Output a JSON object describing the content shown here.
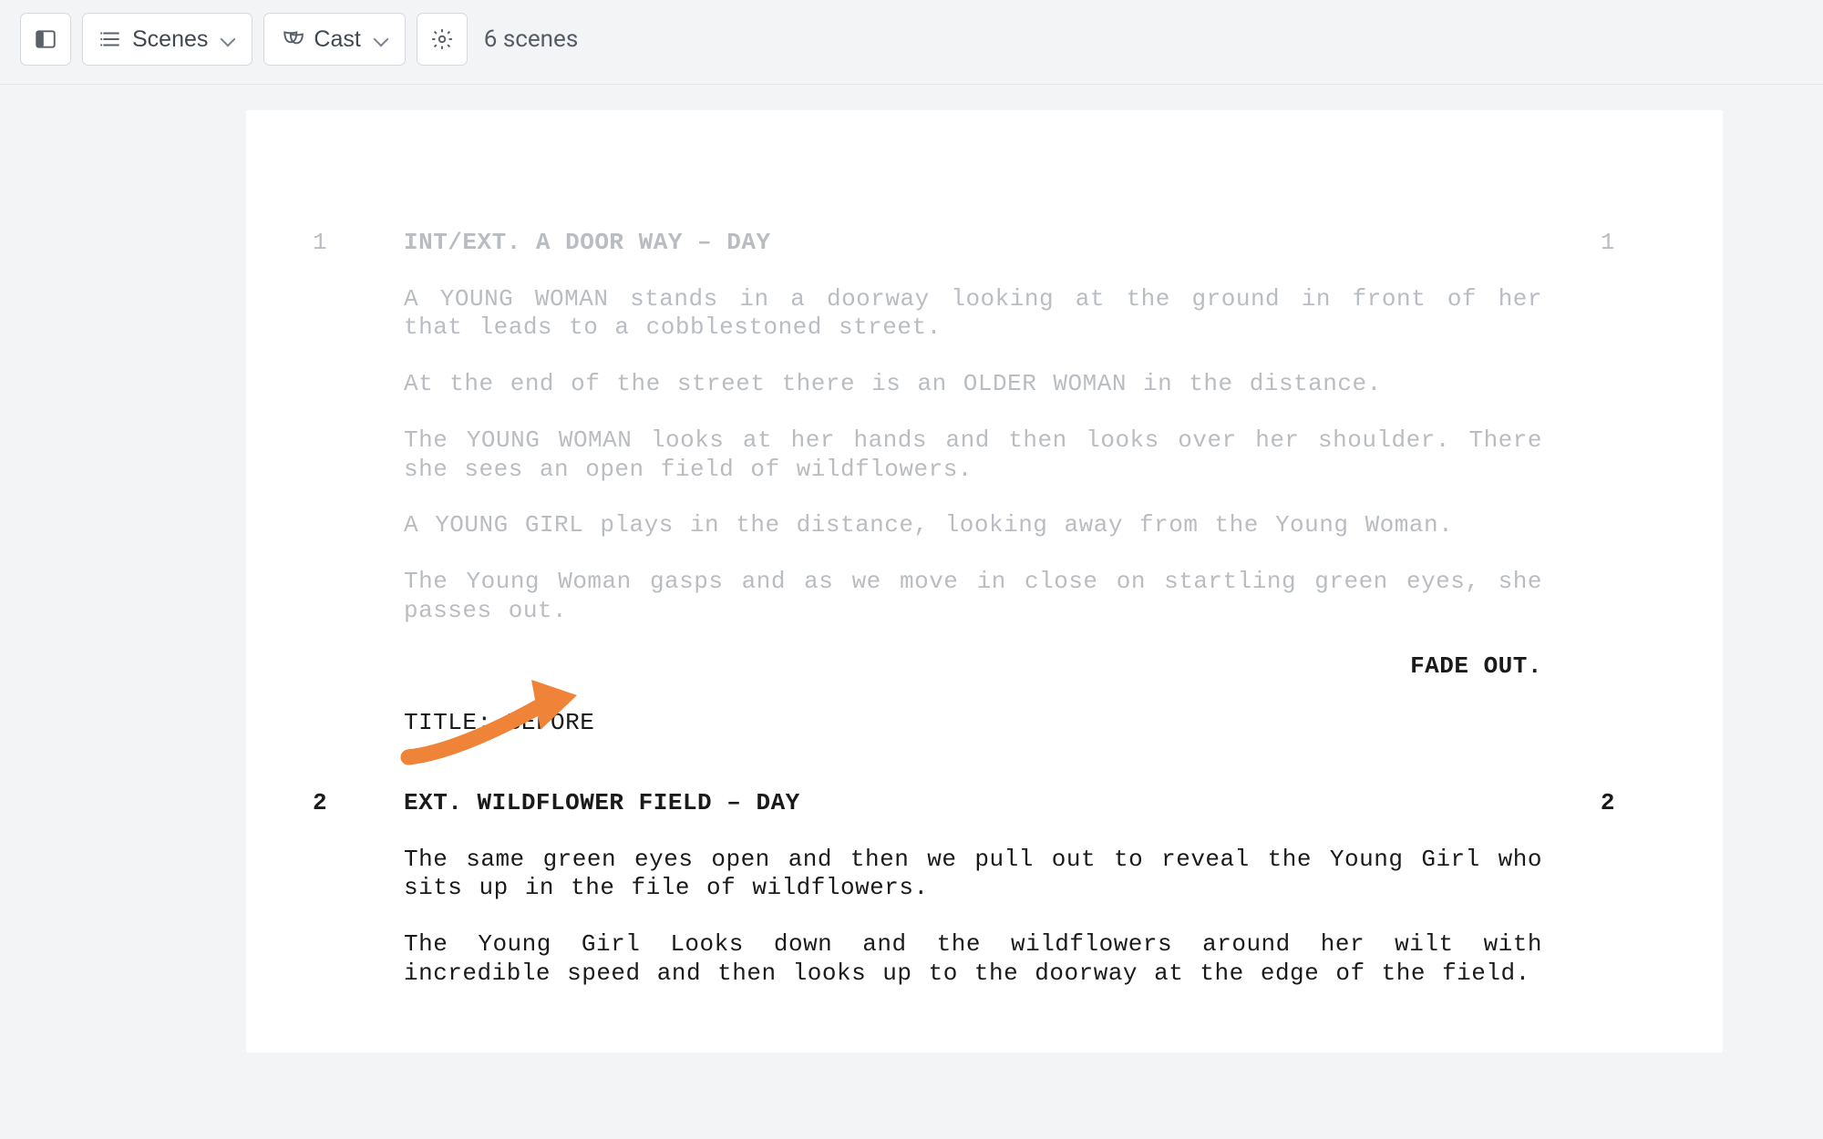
{
  "toolbar": {
    "scenes_label": "Scenes",
    "cast_label": "Cast",
    "scene_count_label": "6 scenes"
  },
  "script": {
    "scene1": {
      "num": "1",
      "slug": "INT/EXT. A DOOR WAY – DAY",
      "p1": "A YOUNG WOMAN stands in a doorway looking at the ground in front of her that leads to a cobblestoned street.",
      "p2": "At the end of the street there is an OLDER WOMAN in the distance.",
      "p3": "The YOUNG WOMAN looks at her hands and then looks over her shoulder. There she sees an open field of wildflowers.",
      "p4": "A YOUNG GIRL plays in the distance, looking away from the Young Woman.",
      "p5": "The Young Woman gasps and as we move in close on startling green eyes, she passes out.",
      "transition": "FADE OUT."
    },
    "title_card": "TITLE: BEFORE",
    "scene2": {
      "num": "2",
      "slug": "EXT. WILDFLOWER FIELD – DAY",
      "p1": "The same green eyes open and then we pull out to reveal the Young Girl who sits up in the file of wildflowers.",
      "p2": "The Young Girl Looks down and the wildflowers around her wilt with incredible speed and then looks up to the doorway at the edge of the field."
    }
  }
}
